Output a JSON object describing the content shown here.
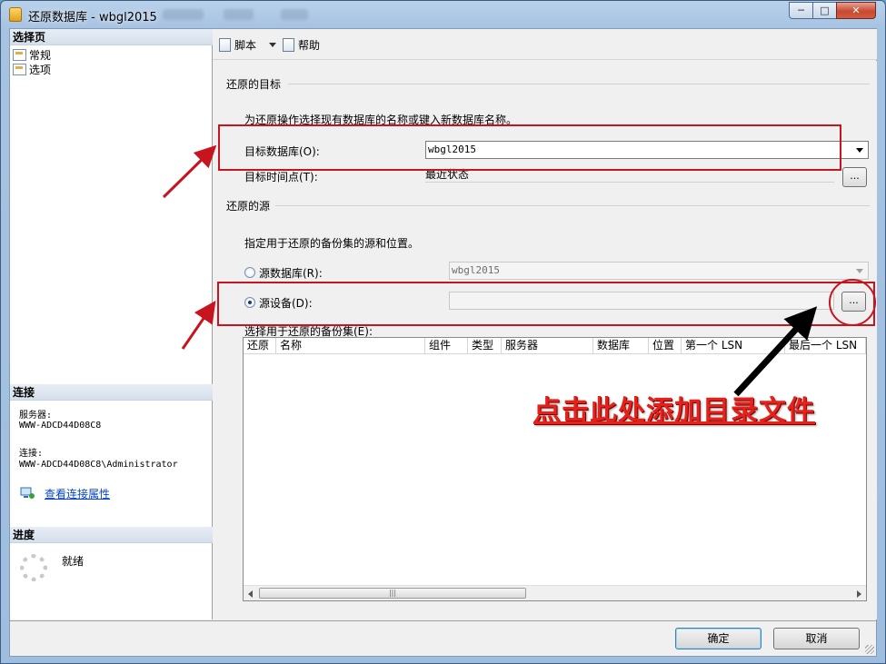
{
  "window": {
    "title": "还原数据库 - wbgl2015",
    "caption_minimize": "─",
    "caption_maximize": "□",
    "caption_close": "✕"
  },
  "left_pane": {
    "select_page_header": "选择页",
    "pages": [
      {
        "label": "常规",
        "icon": "page-icon"
      },
      {
        "label": "选项",
        "icon": "page-icon"
      }
    ],
    "connection_header": "连接",
    "server_label": "服务器:",
    "server_value": "WWW-ADCD44D08C8",
    "connection_label": "连接:",
    "connection_value": "WWW-ADCD44D08C8\\Administrator",
    "view_connection_link": "查看连接属性",
    "progress_header": "进度",
    "progress_status": "就绪"
  },
  "toolbar": {
    "script_label": "脚本",
    "help_label": "帮助"
  },
  "restore_target": {
    "section_title": "还原的目标",
    "description": "为还原操作选择现有数据库的名称或键入新数据库名称。",
    "target_db_label": "目标数据库(O):",
    "target_db_value": "wbgl2015",
    "target_time_label": "目标时间点(T):",
    "target_time_value": "最近状态",
    "browse_label": "..."
  },
  "restore_source": {
    "section_title": "还原的源",
    "description": "指定用于还原的备份集的源和位置。",
    "source_db_label": "源数据库(R):",
    "source_db_value": "wbgl2015",
    "source_db_selected": false,
    "source_device_label": "源设备(D):",
    "source_device_value": "",
    "source_device_selected": true,
    "browse_label": "..."
  },
  "backup_sets": {
    "label": "选择用于还原的备份集(E):",
    "columns": [
      "还原",
      "名称",
      "组件",
      "类型",
      "服务器",
      "数据库",
      "位置",
      "第一个 LSN",
      "最后一个 LSN"
    ],
    "rows": [],
    "scroll_thumb": "|||"
  },
  "footer": {
    "ok_label": "确定",
    "cancel_label": "取消"
  },
  "annotation": {
    "text": "点击此处添加目录文件",
    "color": "#e8201a"
  },
  "colors": {
    "highlight_box": "#c8141e",
    "link": "#0645c8"
  }
}
